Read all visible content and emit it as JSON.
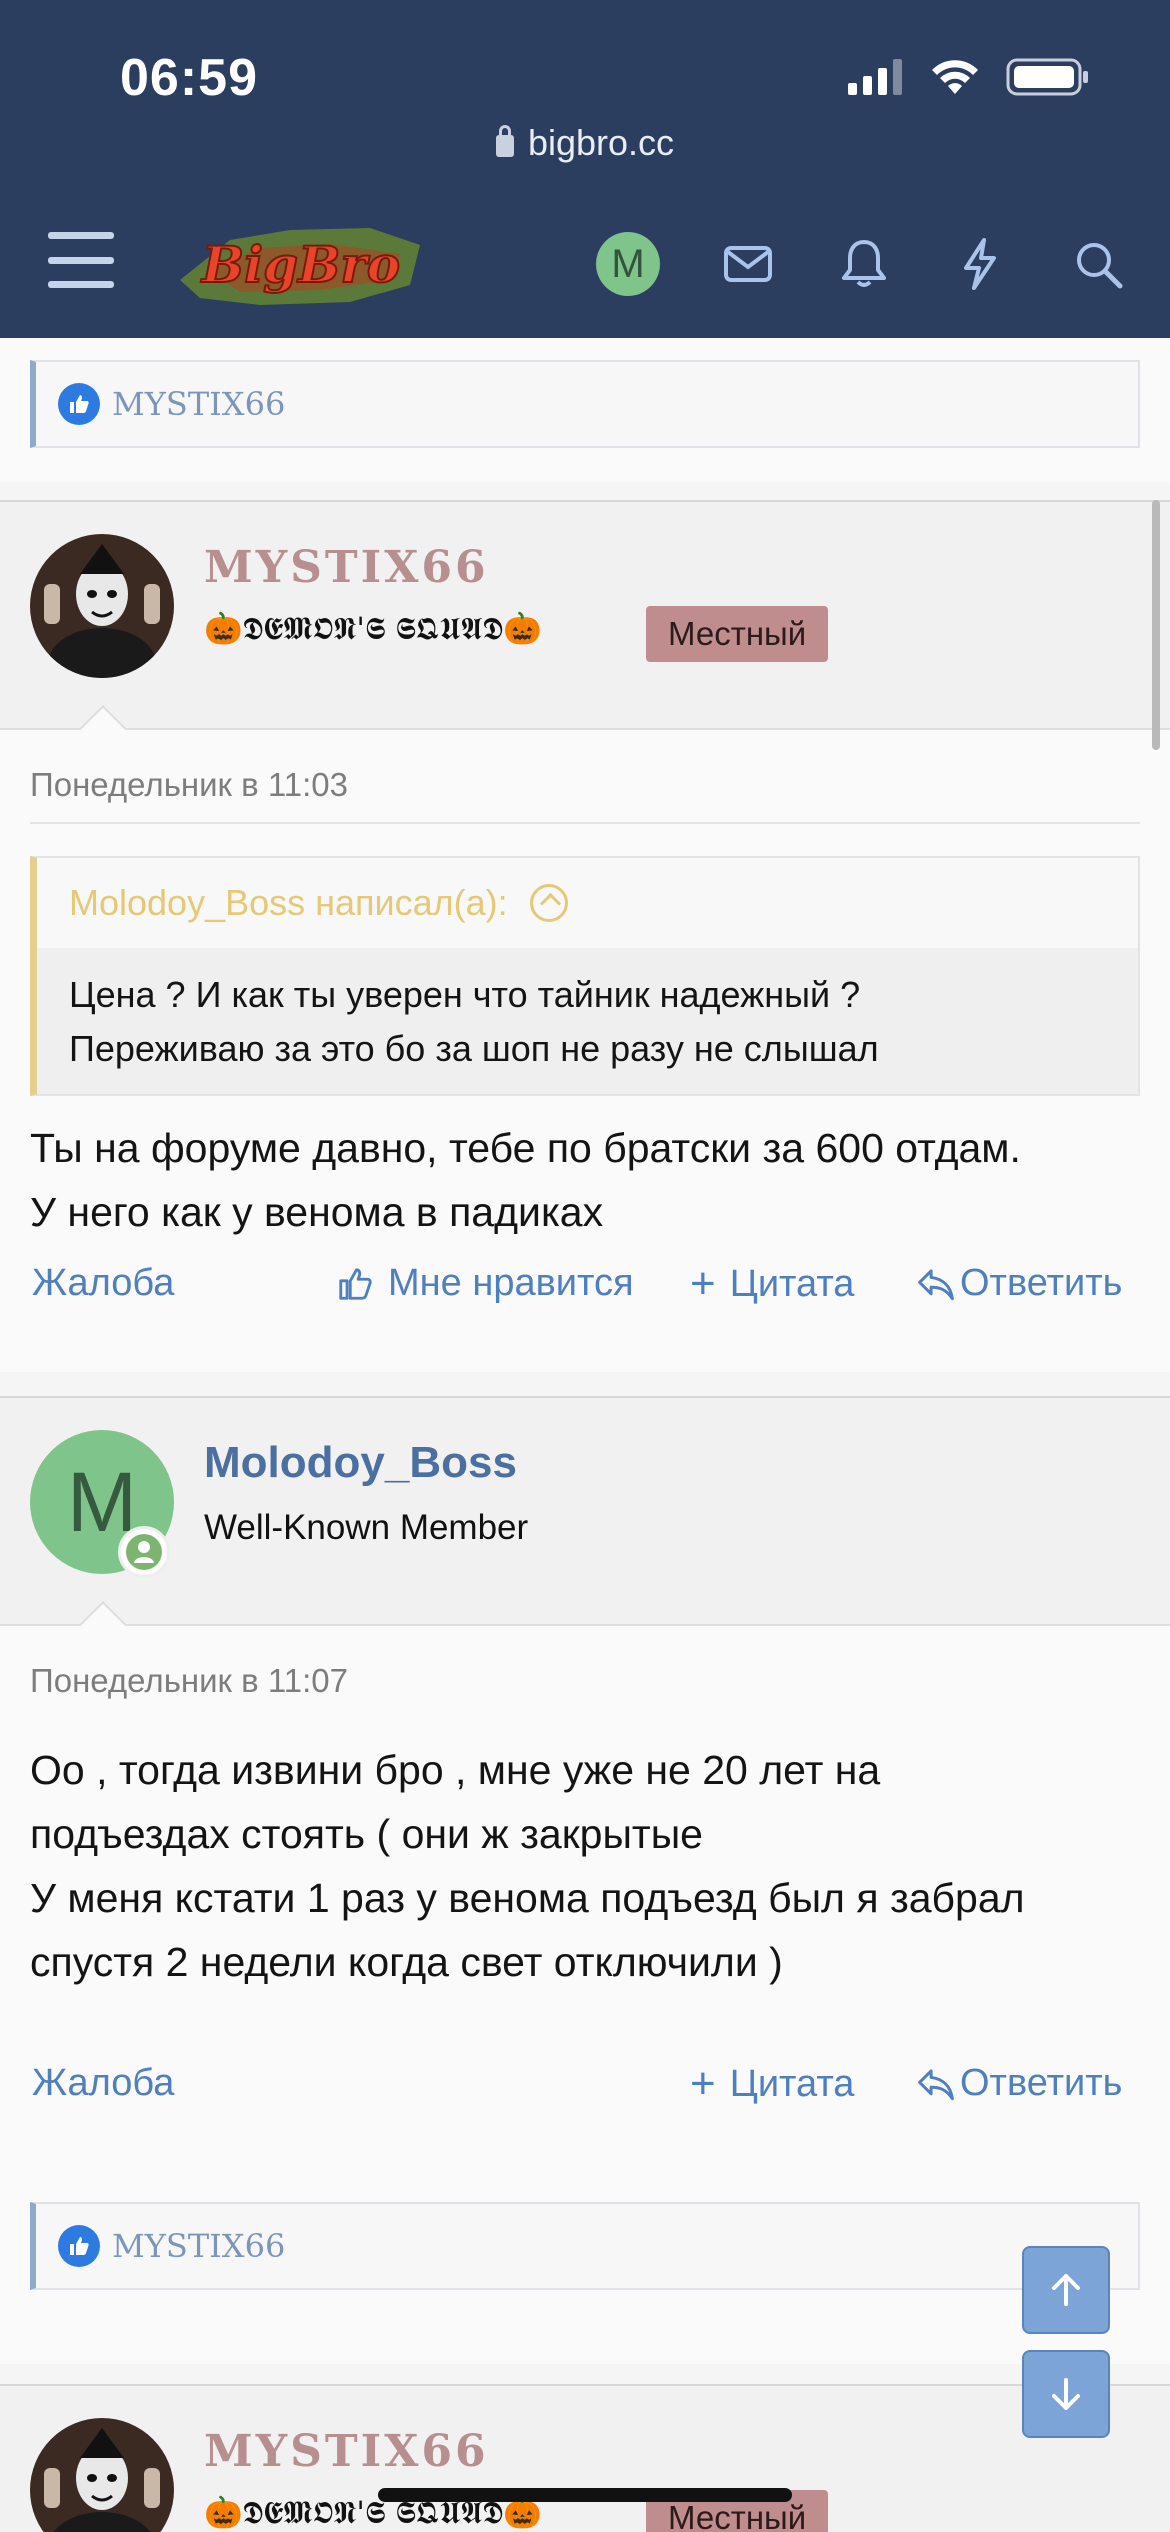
{
  "status_bar": {
    "time": "06:59"
  },
  "browser": {
    "url": "bigbro.cc"
  },
  "nav": {
    "logo_text": "BigBro",
    "avatar_letter": "M"
  },
  "top_likes": {
    "names": "MYSTIX66"
  },
  "posts": [
    {
      "username": "MYSTIX66",
      "user_title": "🎃𝕯𝕰𝕸𝕺𝕹'𝕾 𝕾𝕼𝖀𝕬𝕯🎃",
      "badge": "Местный",
      "date": "Понедельник в 11:03",
      "quote": {
        "author": "Molodoy_Boss написал(а):",
        "lines": [
          "Цена ? И как ты уверен что тайник надежный ?",
          "Переживаю за это бо за шоп не разу не слышал"
        ]
      },
      "message_lines": [
        "Ты на форуме давно, тебе по братски за 600 отдам.",
        "У него как у венома в падиках"
      ],
      "actions": {
        "report": "Жалоба",
        "like": "Мне нравится",
        "quote": "Цитата",
        "reply": "Ответить"
      }
    },
    {
      "username": "Molodoy_Boss",
      "avatar_letter": "M",
      "user_title": "Well-Known Member",
      "date": "Понедельник в 11:07",
      "message_lines": [
        "Оо , тогда извини бро , мне уже не 20 лет на",
        "подъездах стоять ( они ж закрытые",
        "У меня кстати 1 раз у венома подъезд был я забрал",
        "спустя 2 недели когда свет отключили )"
      ],
      "actions": {
        "report": "Жалоба",
        "quote": "Цитата",
        "reply": "Ответить"
      },
      "likes": "MYSTIX66"
    },
    {
      "username": "MYSTIX66",
      "user_title": "🎃𝕯𝕰𝕸𝕺𝕹'𝕾 𝕾𝕼𝖀𝕬𝕯🎃",
      "badge": "Местный"
    }
  ],
  "colors": {
    "header_bg": "#2c3e5f",
    "link": "#4e7fbf",
    "badge_bg": "#bf8d8d",
    "quote_accent": "#e4cf8f"
  },
  "icons": [
    "menu-icon",
    "mail-icon",
    "bell-icon",
    "bolt-icon",
    "search-icon",
    "like-icon",
    "reply-icon",
    "arrow-up-icon",
    "arrow-down-icon"
  ]
}
